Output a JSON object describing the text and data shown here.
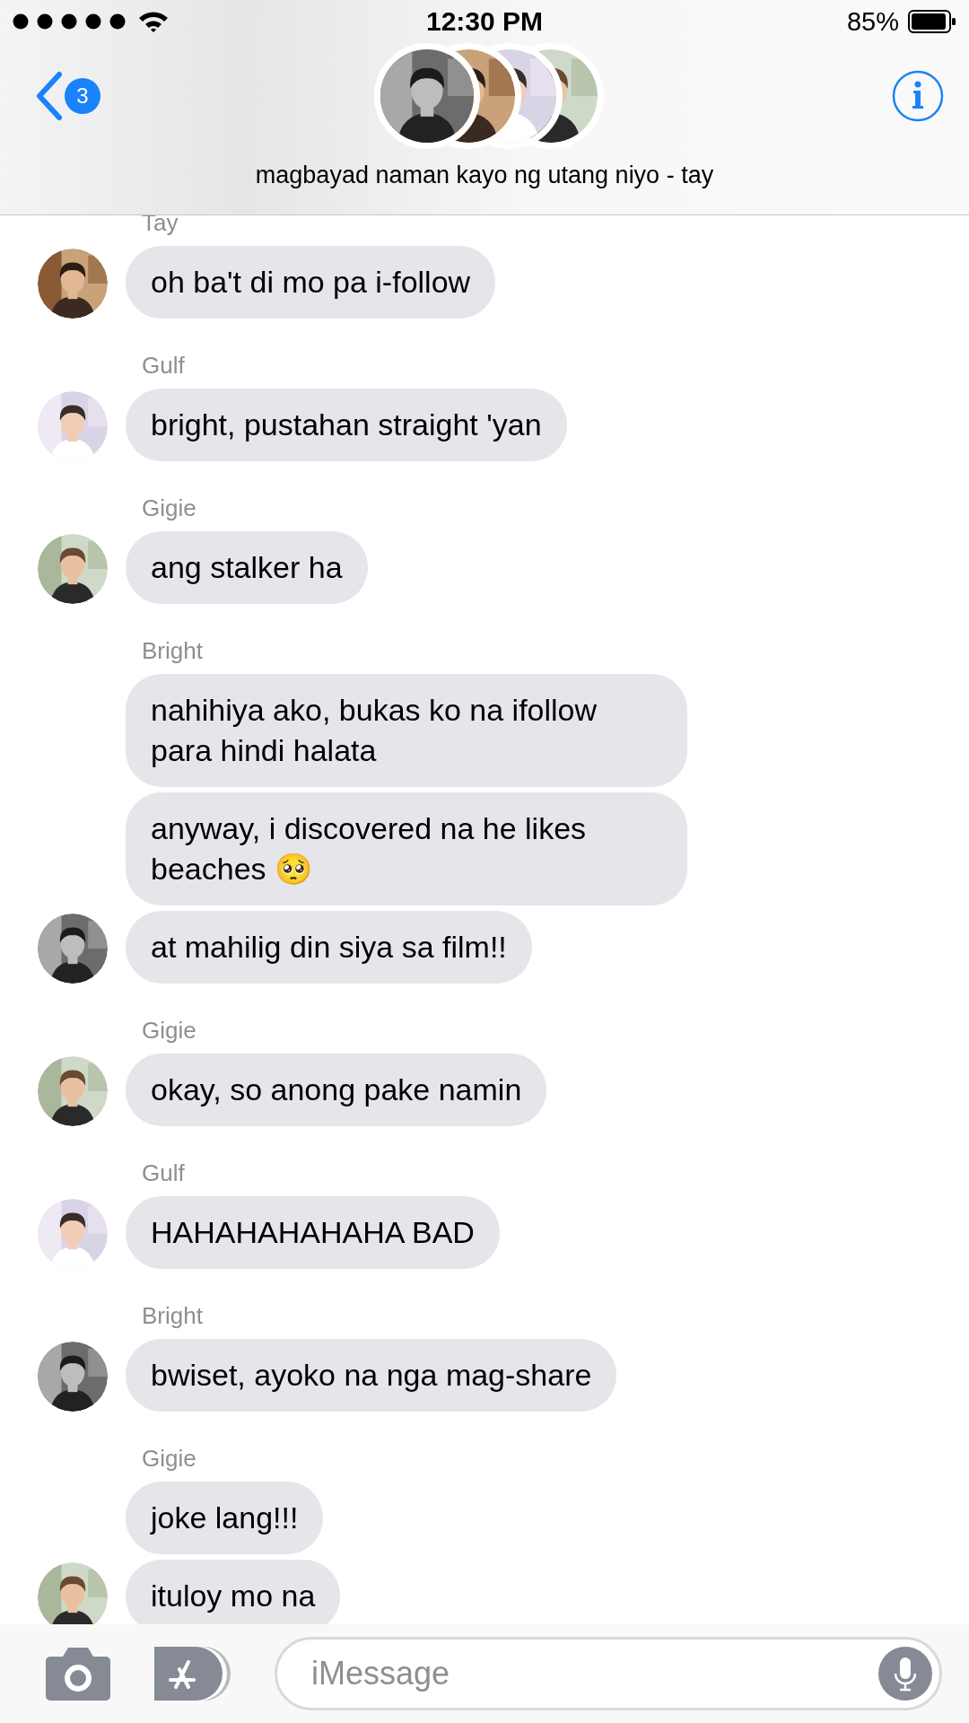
{
  "status_bar": {
    "time": "12:30 PM",
    "battery": "85%"
  },
  "header": {
    "back_count": "3",
    "group_avatars": [
      {
        "kind": "picture"
      },
      {
        "kind": "picture"
      },
      {
        "kind": "picture"
      },
      {
        "kind": "picture"
      }
    ],
    "title": "magbayad naman kayo ng utang niyo - tay"
  },
  "messages": [
    {
      "sender": "Tay",
      "avatar": {
        "kind": "picture"
      },
      "bubbles": [
        {
          "text": "oh ba't di mo pa i-follow"
        }
      ]
    },
    {
      "sender": "Gulf",
      "avatar": {
        "kind": "picture"
      },
      "bubbles": [
        {
          "text": "bright, pustahan straight 'yan"
        }
      ]
    },
    {
      "sender": "Gigie",
      "avatar": {
        "kind": "picture"
      },
      "bubbles": [
        {
          "text": "ang stalker ha"
        }
      ]
    },
    {
      "sender": "Bright",
      "avatar": {
        "kind": "picture"
      },
      "bubbles": [
        {
          "text": "nahihiya ako, bukas ko na ifollow para hindi halata"
        },
        {
          "text": "anyway, i discovered na he likes beaches 🥺"
        },
        {
          "text": "at mahilig din siya sa film!!"
        }
      ]
    },
    {
      "sender": "Gigie",
      "avatar": {
        "kind": "picture"
      },
      "bubbles": [
        {
          "text": "okay, so anong pake namin"
        }
      ]
    },
    {
      "sender": "Gulf",
      "avatar": {
        "kind": "picture"
      },
      "bubbles": [
        {
          "text": "HAHAHAHAHAHA BAD"
        }
      ]
    },
    {
      "sender": "Bright",
      "avatar": {
        "kind": "picture"
      },
      "bubbles": [
        {
          "text": "bwiset, ayoko na nga mag-share"
        }
      ]
    },
    {
      "sender": "Gigie",
      "avatar": {
        "kind": "picture"
      },
      "bubbles": [
        {
          "text": "joke lang!!!"
        },
        {
          "text": "ituloy mo na"
        }
      ]
    }
  ],
  "composer": {
    "placeholder": "iMessage"
  }
}
